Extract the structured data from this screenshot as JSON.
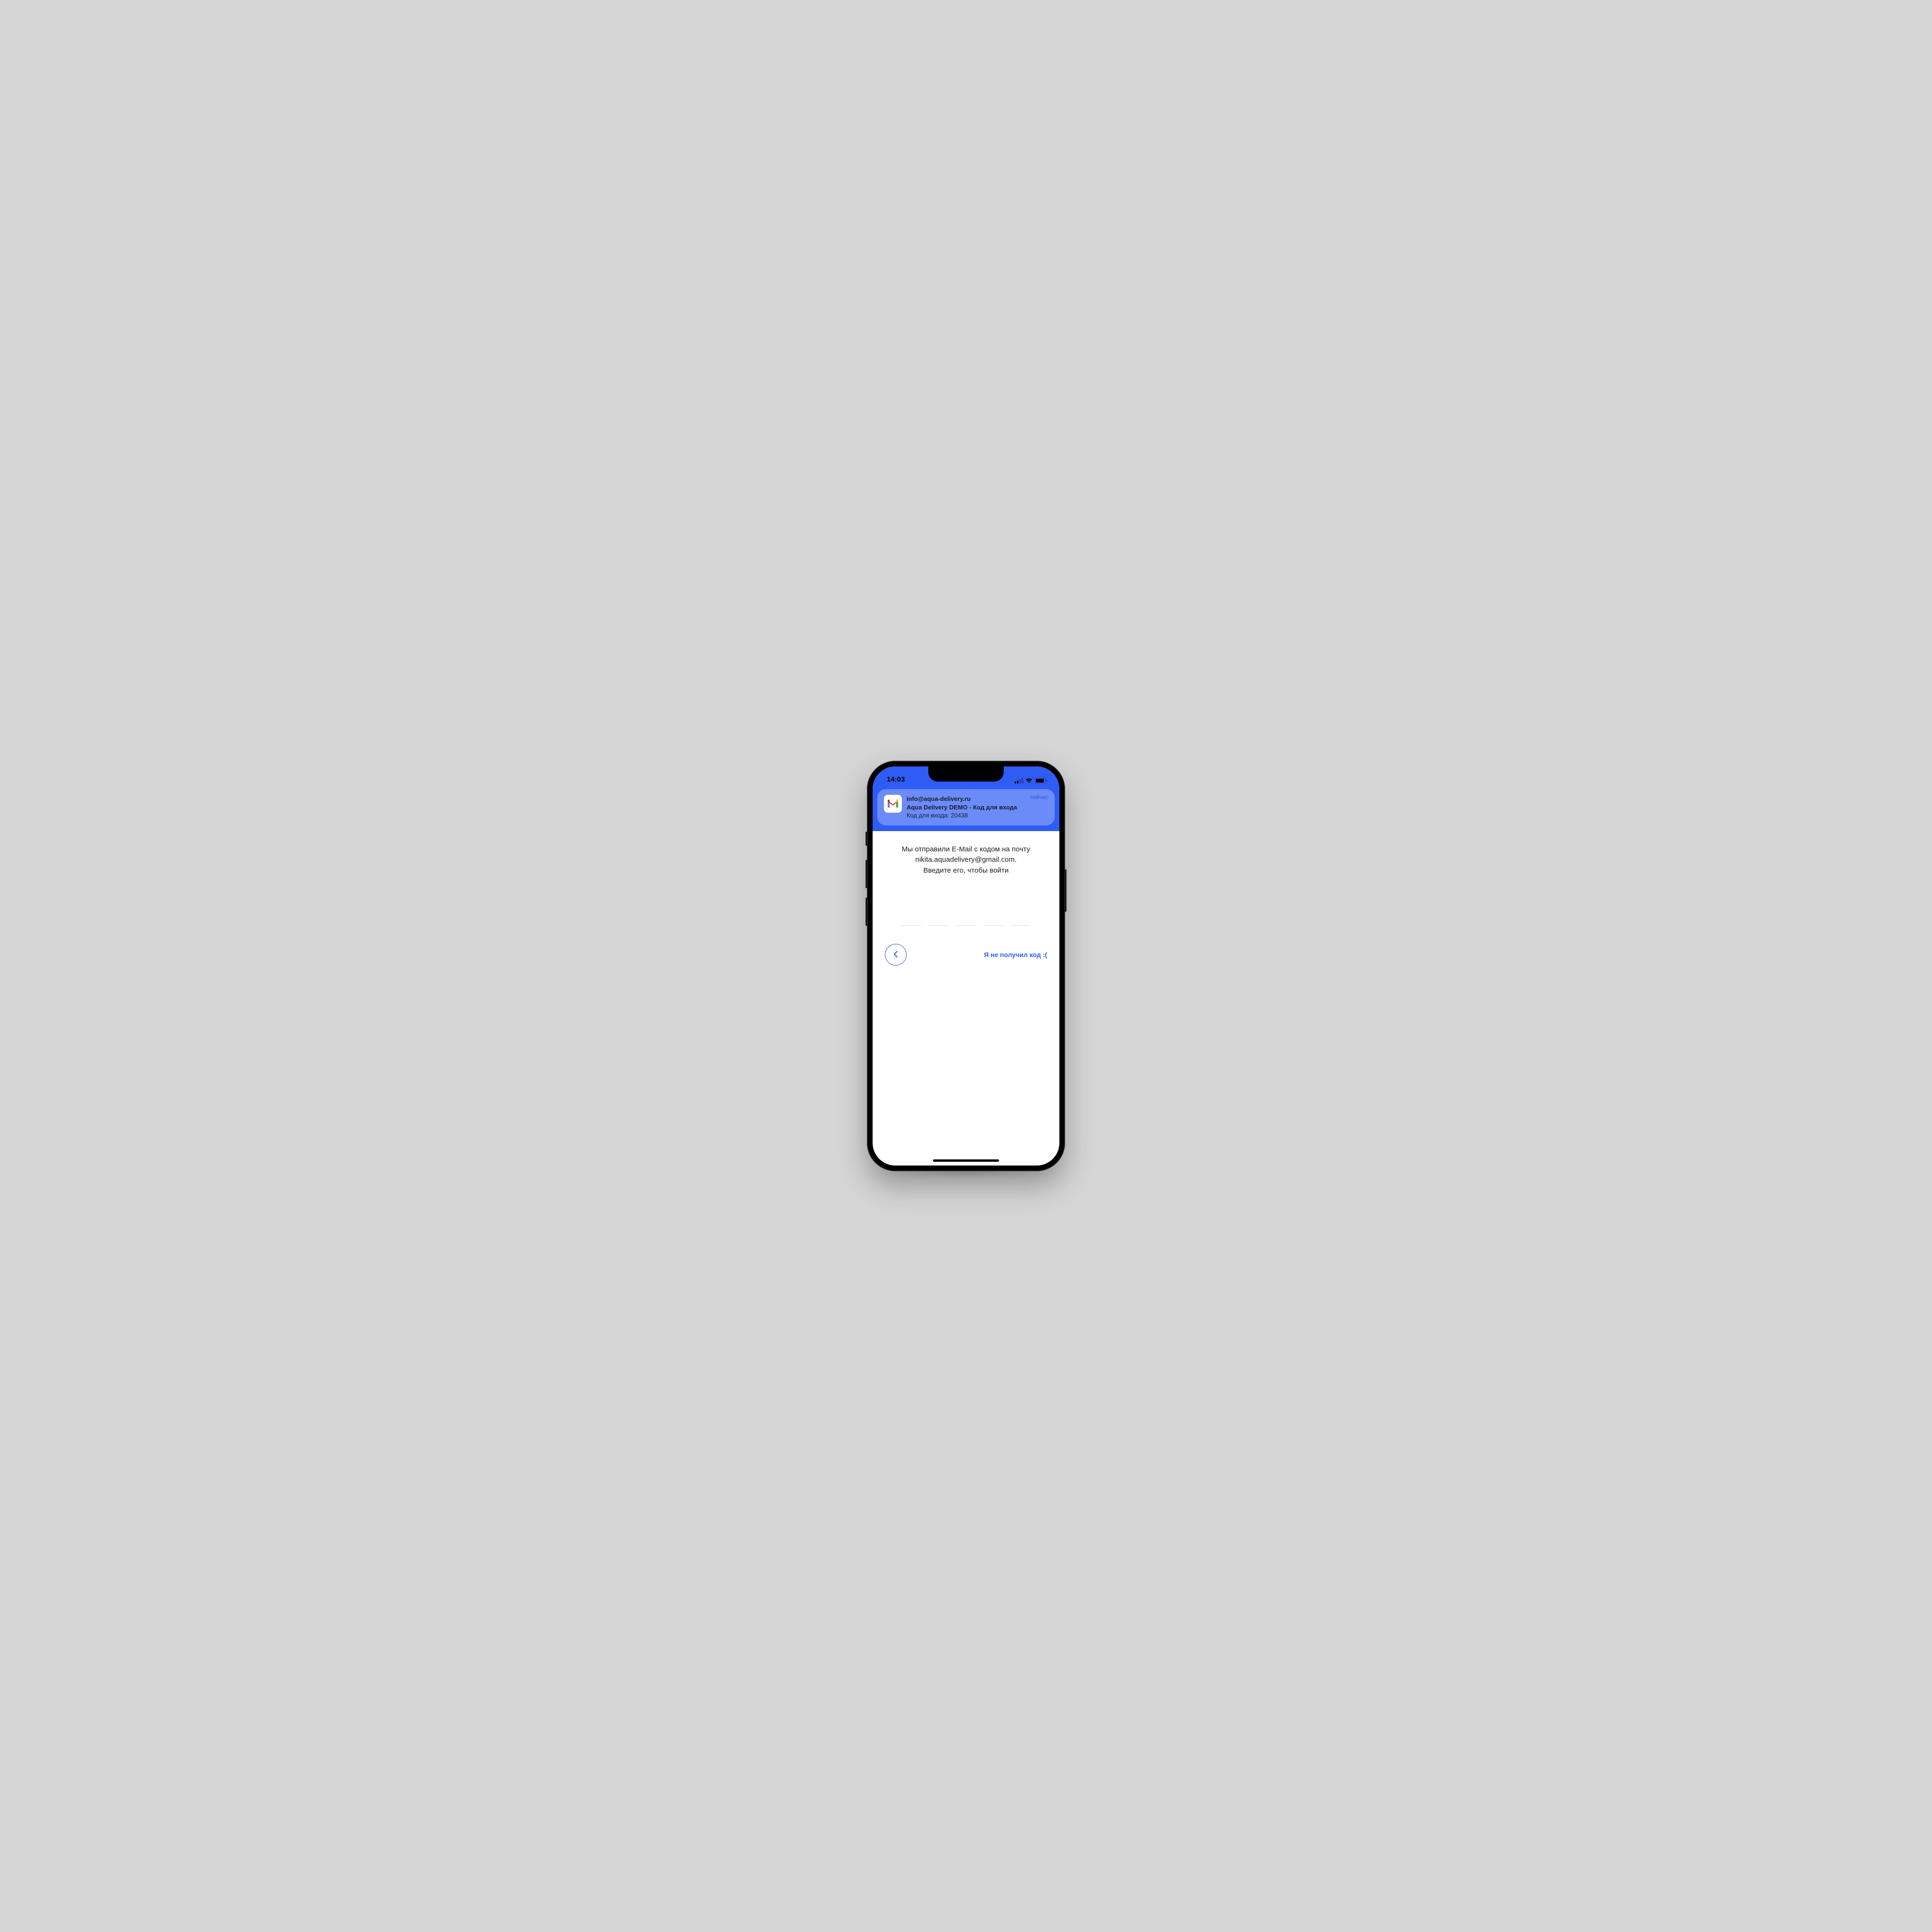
{
  "status_bar": {
    "time": "14:03"
  },
  "notification": {
    "sender": "info@aqua-delivery.ru",
    "subject": "Aqua Delivery DEMO - Код для входа",
    "body": "Код для входа: 20438",
    "when": "сейчас",
    "app_icon_name": "gmail-icon"
  },
  "main": {
    "instruction_line1": "Мы отправили E-Mail с кодом на почту",
    "instruction_line2": "nikita.aquadelivery@gmail.com.",
    "instruction_line3": "Введите его, чтобы войти",
    "code_digits": [
      "",
      "",
      "",
      "",
      ""
    ],
    "no_code_label": "Я не получил код :("
  },
  "colors": {
    "accent": "#2f5cf5",
    "notification_bg": "#6b8cf8"
  }
}
